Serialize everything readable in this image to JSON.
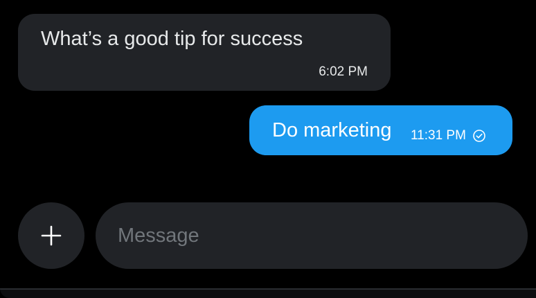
{
  "conversation": {
    "messages": [
      {
        "direction": "received",
        "text": "What’s a good tip for success",
        "time": "6:02 PM"
      },
      {
        "direction": "sent",
        "text": "Do marketing",
        "time": "11:31 PM",
        "status_icon": "check-circle-icon"
      }
    ]
  },
  "composer": {
    "add_icon": "plus-icon",
    "input_value": "",
    "input_placeholder": "Message"
  },
  "colors": {
    "background": "#000000",
    "received_bubble": "#212327",
    "sent_bubble": "#1d9bf0",
    "composer_field": "#212327",
    "placeholder": "#71767b",
    "text": "#e7e9ea"
  }
}
